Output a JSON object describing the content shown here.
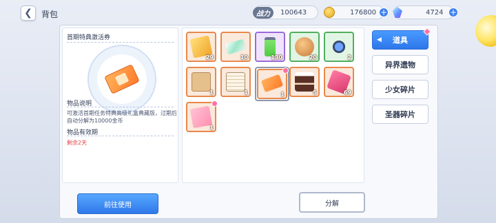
{
  "header": {
    "title": "背包",
    "power_label": "战力",
    "power_value": "100643",
    "gold_value": "176800",
    "gem_value": "4724"
  },
  "detail": {
    "item_name": "首期特典激活券",
    "desc_title": "物品说明",
    "desc_text": "可激活首期任务特典高级礼盒典藏版，过期后自动分解为10000金币",
    "validity_title": "物品有效期",
    "remaining": "剩余2天"
  },
  "items": [
    {
      "name": "item-cards-gold",
      "count": "29"
    },
    {
      "name": "item-ticket",
      "count": "10"
    },
    {
      "name": "item-battery",
      "count": "130"
    },
    {
      "name": "item-coins",
      "count": "20"
    },
    {
      "name": "item-drone",
      "count": "2"
    },
    {
      "name": "item-envelope-brown",
      "count": "1"
    },
    {
      "name": "item-document",
      "count": "1"
    },
    {
      "name": "item-activation-ticket",
      "count": "1"
    },
    {
      "name": "item-cake",
      "count": "5"
    },
    {
      "name": "item-ribbon",
      "count": "69"
    },
    {
      "name": "item-envelope-pink",
      "count": "1"
    }
  ],
  "tabs": {
    "items": "道具",
    "relics": "异界遗物",
    "girl_shards": "少女碎片",
    "artifact_shards": "圣器碎片"
  },
  "buttons": {
    "use": "前往使用",
    "decompose": "分解"
  },
  "colors": {
    "accent_blue": "#2e78ea",
    "orange_border": "#e8884a",
    "purple_border": "#9b6ad8",
    "green_border": "#4fae5e",
    "badge_pink": "#ff6fa6",
    "warning_red": "#e04040"
  }
}
